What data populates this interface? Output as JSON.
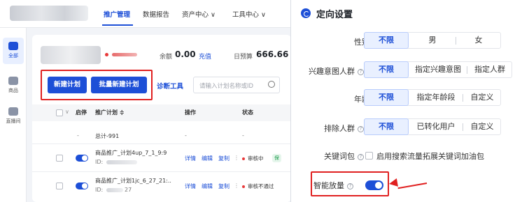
{
  "left_panel": {
    "top_nav": [
      "推广管理",
      "数据报告",
      "资产中心 ∨",
      "工具中心 ∨"
    ],
    "sidebar": [
      "全部",
      "商品",
      "直播间"
    ],
    "account": {
      "balance_label": "余额",
      "balance_value": "0.00",
      "recharge": "充值",
      "daily_budget_label": "日预算",
      "daily_budget_value": "666.66"
    },
    "buttons": {
      "new_plan": "新建计划",
      "batch_new_plan": "批量新建计划",
      "diagnose": "诊断工具"
    },
    "search_placeholder": "请输入计划名称或ID",
    "table": {
      "headers": [
        "启停",
        "推广计划 ≑",
        "操作",
        "状态"
      ],
      "summary_label": "总计-991",
      "summary_dash_1": "-",
      "summary_dash_2": "-",
      "summary_dash_3": "-",
      "rows": [
        {
          "name": "商品推广_计划4up_7_1_9:9",
          "id_prefix": "ID:",
          "actions": [
            "详情",
            "编辑",
            "复制"
          ],
          "status": "审核中",
          "tag": "保"
        },
        {
          "name": "商品推广_计划1jc_6_27_21:..",
          "id_prefix": "ID:",
          "id_suffix": "27",
          "actions": [
            "详情",
            "编辑",
            "复制"
          ],
          "status": "审核不通过"
        }
      ]
    }
  },
  "right_panel": {
    "title": "定向设置",
    "fields": [
      {
        "label": "性别",
        "options": [
          "不限",
          "男",
          "女"
        ],
        "selected": "不限"
      },
      {
        "label": "兴趣意图人群",
        "options": [
          "不限",
          "指定兴趣意图",
          "指定人群"
        ],
        "selected": "不限"
      },
      {
        "label": "年龄",
        "options": [
          "不限",
          "指定年龄段",
          "自定义"
        ],
        "selected": "不限"
      },
      {
        "label": "排除人群",
        "options": [
          "不限",
          "已转化用户",
          "自定义"
        ],
        "selected": "不限"
      }
    ],
    "keyword_pack": {
      "label": "关键词包",
      "checkbox_label": "启用搜索流量拓展关键词加油包"
    },
    "smart_boost": {
      "label": "智能放量",
      "enabled": true
    },
    "colors": {
      "accent": "#1d4fd7",
      "highlight": "#e02020"
    }
  }
}
